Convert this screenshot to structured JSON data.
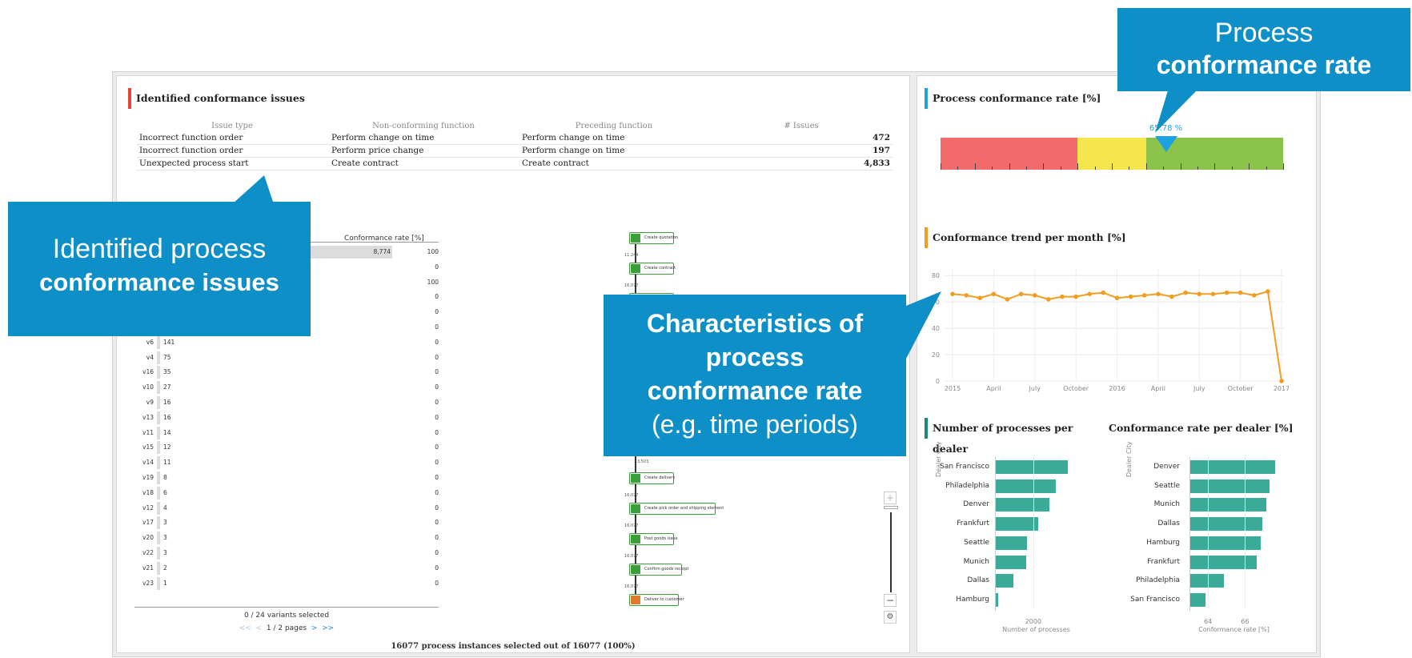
{
  "issues_section": {
    "title": "Identified conformance issues",
    "accent": "#e8443a",
    "columns": [
      "Issue type",
      "Non-conforming function",
      "Preceding function",
      "# Issues"
    ],
    "rows": [
      {
        "type": "Incorrect function order",
        "function": "Perform change on time",
        "preceding": "Perform change on time",
        "count": "472"
      },
      {
        "type": "Incorrect function order",
        "function": "Perform price change",
        "preceding": "Perform change on time",
        "count": "197"
      },
      {
        "type": "Unexpected process start",
        "function": "Create contract",
        "preceding": "Create contract",
        "count": "4,833"
      }
    ]
  },
  "variants": {
    "rate_header": "Conformance rate [%]",
    "first_row": {
      "count": "8,774",
      "rate": "100"
    },
    "hidden_rows_rates": [
      "0",
      "100",
      "0",
      "0",
      "0"
    ],
    "rows": [
      {
        "name": "v6",
        "count": "141",
        "rate": "0"
      },
      {
        "name": "v4",
        "count": "75",
        "rate": "0"
      },
      {
        "name": "v16",
        "count": "35",
        "rate": "0"
      },
      {
        "name": "v10",
        "count": "27",
        "rate": "0"
      },
      {
        "name": "v9",
        "count": "16",
        "rate": "0"
      },
      {
        "name": "v13",
        "count": "16",
        "rate": "0"
      },
      {
        "name": "v11",
        "count": "14",
        "rate": "0"
      },
      {
        "name": "v15",
        "count": "12",
        "rate": "0"
      },
      {
        "name": "v14",
        "count": "11",
        "rate": "0"
      },
      {
        "name": "v19",
        "count": "8",
        "rate": "0"
      },
      {
        "name": "v18",
        "count": "6",
        "rate": "0"
      },
      {
        "name": "v12",
        "count": "4",
        "rate": "0"
      },
      {
        "name": "v17",
        "count": "3",
        "rate": "0"
      },
      {
        "name": "v20",
        "count": "3",
        "rate": "0"
      },
      {
        "name": "v22",
        "count": "3",
        "rate": "0"
      },
      {
        "name": "v21",
        "count": "2",
        "rate": "0"
      },
      {
        "name": "v23",
        "count": "1",
        "rate": "0"
      }
    ],
    "selected_text": "0 / 24 variants selected",
    "pager_first": "<<",
    "pager_prev": "<",
    "pager_text": "1 / 2 pages",
    "pager_next": ">",
    "pager_last": ">>"
  },
  "flow": {
    "nodes": [
      "Create quotation",
      "Create contract",
      "",
      "Create delivery",
      "Create pick order and shipping element",
      "Post goods issue",
      "Confirm goods receipt",
      "Deliver to customer"
    ],
    "edge_labels": [
      "11,244",
      "16,077",
      "3,503",
      "16,077",
      "16,077",
      "16,077",
      "16,077"
    ]
  },
  "footer_status": "16077 process instances selected out of 16077 (100%)",
  "gauge": {
    "title": "Process conformance rate [%]",
    "accent": "#1ea1e0",
    "value_label": "65.78 %",
    "value": 65.78,
    "colors": {
      "low": "#f26b6b",
      "mid": "#f5e64e",
      "high": "#8cc44b",
      "marker": "#1ea1e0"
    }
  },
  "trend": {
    "title": "Conformance trend per month [%]",
    "accent": "#f39c1f"
  },
  "chart_data": [
    {
      "type": "line",
      "x_tick_labels": [
        "2015",
        "April",
        "July",
        "October",
        "2016",
        "April",
        "July",
        "October",
        "2017"
      ],
      "y_ticks": [
        "0",
        "20",
        "40",
        "60",
        "80"
      ],
      "ylim": [
        0,
        85
      ],
      "values": [
        66,
        65,
        63,
        66,
        62,
        66,
        65,
        62,
        64,
        64,
        66,
        67,
        63,
        64,
        65,
        66,
        64,
        67,
        66,
        66,
        67,
        67,
        65,
        68,
        0
      ],
      "color": "#f39c1f"
    },
    {
      "type": "bar",
      "orientation": "horizontal",
      "title": "Number of processes per dealer",
      "ylabel": "Dealer City",
      "xlabel": "Number of processes",
      "x_ticks": [
        "2000"
      ],
      "categories": [
        "San Francisco",
        "Philadelphia",
        "Denver",
        "Frankfurt",
        "Seattle",
        "Munich",
        "Dallas",
        "Hamburg"
      ],
      "values": [
        3000,
        2650,
        2450,
        2120,
        1790,
        1770,
        1400,
        900
      ],
      "xlim": [
        870,
        3300
      ],
      "color": "#3aab98"
    },
    {
      "type": "bar",
      "orientation": "horizontal",
      "title": "Conformance rate per dealer [%]",
      "ylabel": "Dealer City",
      "xlabel": "Conformance rate [%]",
      "x_ticks": [
        "64",
        "66"
      ],
      "categories": [
        "Denver",
        "Seattle",
        "Munich",
        "Dallas",
        "Hamburg",
        "Frankfurt",
        "Philadelphia",
        "San Francisco"
      ],
      "values": [
        67.6,
        67.3,
        67.1,
        66.9,
        66.8,
        66.6,
        64.8,
        63.8
      ],
      "xlim": [
        63,
        67.8
      ],
      "color": "#3aab98"
    }
  ],
  "dealer_section": {
    "accent": "#1a8a7a"
  },
  "callouts": {
    "rate_line1": "Process",
    "rate_line2": "conformance rate",
    "issues_line1": "Identified process",
    "issues_line2": "conformance issues",
    "chars_line1": "Characteristics of",
    "chars_line2": "process",
    "chars_line3": "conformance rate",
    "chars_line4": "(e.g. time periods)",
    "color": "#0f8fc7"
  },
  "zoom": {
    "plus": "+",
    "minus": "−",
    "settings": "⚙"
  }
}
